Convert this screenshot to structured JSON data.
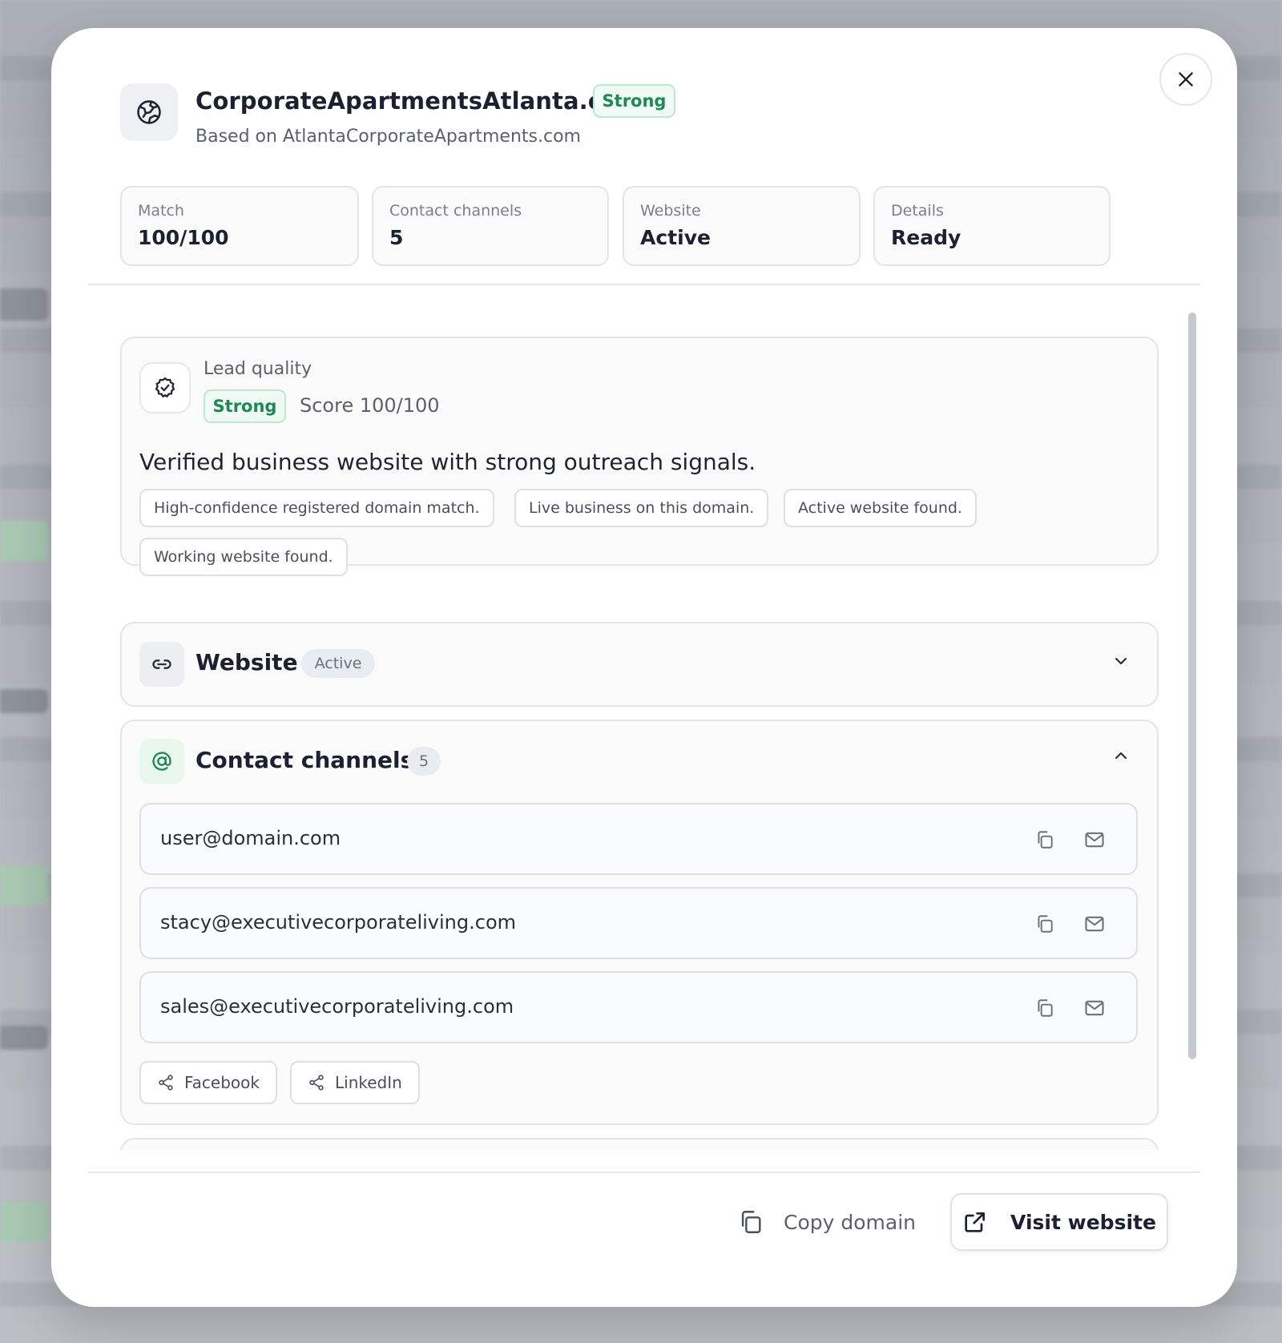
{
  "header": {
    "title": "CorporateApartmentsAtlanta.com",
    "badge": "Strong",
    "subtitle": "Based on AtlantaCorporateApartments.com"
  },
  "stats": [
    {
      "label": "Match",
      "value": "100/100"
    },
    {
      "label": "Contact channels",
      "value": "5"
    },
    {
      "label": "Website",
      "value": "Active"
    },
    {
      "label": "Details",
      "value": "Ready"
    }
  ],
  "lead_quality": {
    "label": "Lead quality",
    "badge": "Strong",
    "score": "Score 100/100",
    "summary": "Verified business website with strong outreach signals.",
    "signals": [
      "High-confidence registered domain match.",
      "Live business on this domain.",
      "Active website found.",
      "Working website found."
    ]
  },
  "website_section": {
    "title": "Website",
    "status": "Active",
    "expanded": false
  },
  "contact_section": {
    "title": "Contact channels",
    "count": "5",
    "expanded": true,
    "emails": [
      "user@domain.com",
      "stacy@executivecorporateliving.com",
      "sales@executivecorporateliving.com"
    ],
    "socials": [
      "Facebook",
      "LinkedIn"
    ]
  },
  "footer": {
    "copy_label": "Copy domain",
    "visit_label": "Visit website"
  },
  "colors": {
    "accent_green": "#1c8a52",
    "badge_bg": "#eefaf3",
    "border": "#e2e5e9"
  },
  "icons": {
    "header": "globe-icon",
    "close": "close-icon",
    "lead_quality": "check-badge-icon",
    "website": "link-icon",
    "contact": "at-sign-icon",
    "copy": "copy-icon",
    "mail": "mail-icon",
    "share": "share-icon",
    "external": "external-link-icon"
  }
}
